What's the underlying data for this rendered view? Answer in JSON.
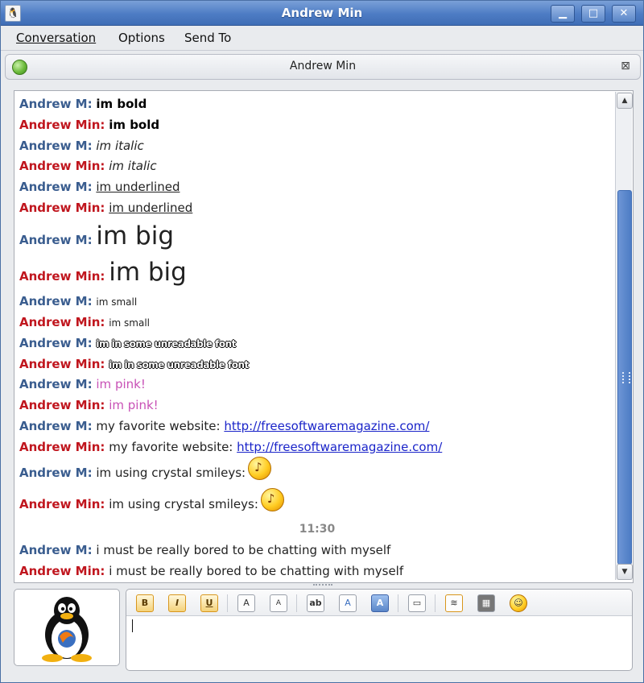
{
  "window": {
    "title": "Andrew Min",
    "minimize": "▁",
    "maximize": "□",
    "close": "✕"
  },
  "menu": {
    "conversation": "Conversation",
    "options": "Options",
    "send_to": "Send To"
  },
  "conversation": {
    "title": "Andrew Min",
    "status": "online",
    "close_label": "⊠"
  },
  "messages": [
    {
      "nick": "Andrew M:",
      "text": "im bold"
    },
    {
      "nick": "Andrew Min:",
      "text": "im bold"
    },
    {
      "nick": "Andrew M:",
      "text": "im italic"
    },
    {
      "nick": "Andrew Min:",
      "text": "im italic"
    },
    {
      "nick": "Andrew M:",
      "text": "im underlined"
    },
    {
      "nick": "Andrew Min:",
      "text": "im underlined"
    },
    {
      "nick": "Andrew M:",
      "text": "im big"
    },
    {
      "nick": "Andrew Min:",
      "text": "im big"
    },
    {
      "nick": "Andrew M:",
      "text": "im small"
    },
    {
      "nick": "Andrew Min:",
      "text": "im small"
    },
    {
      "nick": "Andrew M:",
      "text": "im in some unreadable font"
    },
    {
      "nick": "Andrew Min:",
      "text": "im in some unreadable font"
    },
    {
      "nick": "Andrew M:",
      "text": "im pink!"
    },
    {
      "nick": "Andrew Min:",
      "text": "im pink!"
    },
    {
      "nick": "Andrew M:",
      "text": "my favorite website:",
      "link": "http://freesoftwaremagazine.com/"
    },
    {
      "nick": "Andrew Min:",
      "text": "my favorite website:",
      "link": "http://freesoftwaremagazine.com/"
    },
    {
      "nick": "Andrew M:",
      "text": "im using crystal smileys:"
    },
    {
      "nick": "Andrew Min:",
      "text": "im using crystal smileys:"
    },
    {
      "nick": "Andrew M:",
      "text": "i must be really bored to be chatting with myself"
    },
    {
      "nick": "Andrew Min:",
      "text": "i must be really bored to be chatting with myself"
    }
  ],
  "timestamp": "11:30",
  "toolbar": {
    "bold": "B",
    "italic": "I",
    "underline": "U",
    "larger": "A",
    "smaller": "A",
    "font_face": "ab",
    "fg_color": "A",
    "bg_color": "A"
  },
  "icons": {
    "app": "pidgin-icon",
    "smiley": "crystal-smiley-icon",
    "buddy": "tux-penguin-icon",
    "insert_image": "insert-image-icon",
    "insert_link": "insert-link-icon",
    "insert_rule": "horizontal-rule-icon",
    "insert_smiley": "smiley-icon"
  },
  "colors": {
    "titlebar": "#4d7cc4",
    "nick_self": "#3a5d8f",
    "nick_other": "#c0161e",
    "pink": "#c851b6",
    "link": "#1a24c9",
    "scroll_thumb": "#4d7cc4"
  }
}
